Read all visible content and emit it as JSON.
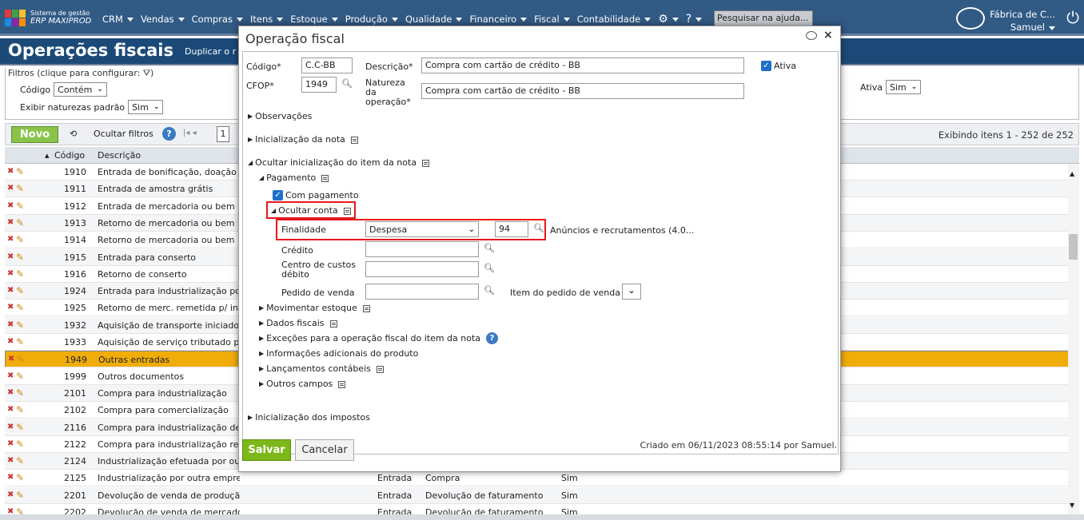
{
  "app": {
    "brand_line1": "Sistema de gestão",
    "brand_line2": "ERP MAXIPROD"
  },
  "menu": [
    "CRM",
    "Vendas",
    "Compras",
    "Itens",
    "Estoque",
    "Produção",
    "Qualidade",
    "Financeiro",
    "Fiscal",
    "Contabilidade"
  ],
  "help_search": {
    "placeholder": "Pesquisar na ajuda..."
  },
  "user": {
    "company": "Fábrica de C...",
    "name": "Samuel"
  },
  "page": {
    "title": "Operações fiscais",
    "duplicate_label": "Duplicar o r"
  },
  "filters": {
    "legend": "Filtros (clique para configurar:",
    "codigo_label": "Código",
    "codigo_op": "Contém",
    "naturezas_label": "Exibir naturezas padrão",
    "naturezas_value": "Sim",
    "ativa_label": "Ativa",
    "ativa_value": "Sim"
  },
  "toolbar": {
    "novo": "Novo",
    "hide_filters": "Ocultar filtros",
    "page": "1",
    "count": "Exibindo itens 1 - 252 de 252"
  },
  "grid": {
    "headers": {
      "codigo": "Código",
      "descricao": "Descrição"
    },
    "rows": [
      {
        "codigo": "1910",
        "descricao": "Entrada de bonificação, doação ou",
        "c3": "",
        "c4": "",
        "c5": ""
      },
      {
        "codigo": "1911",
        "descricao": "Entrada de amostra grátis",
        "c3": "",
        "c4": "",
        "c5": ""
      },
      {
        "codigo": "1912",
        "descricao": "Entrada de mercadoria ou bem rec",
        "c3": "",
        "c4": "",
        "c5": ""
      },
      {
        "codigo": "1913",
        "descricao": "Retorno de mercadoria ou bem re",
        "c3": "",
        "c4": "",
        "c5": ""
      },
      {
        "codigo": "1914",
        "descricao": "Retorno de mercadoria ou bem re",
        "c3": "",
        "c4": "",
        "c5": ""
      },
      {
        "codigo": "1915",
        "descricao": "Entrada para conserto",
        "c3": "",
        "c4": "",
        "c5": ""
      },
      {
        "codigo": "1916",
        "descricao": "Retorno de conserto",
        "c3": "",
        "c4": "",
        "c5": ""
      },
      {
        "codigo": "1924",
        "descricao": "Entrada para industrialização por",
        "c3": "",
        "c4": "",
        "c5": ""
      },
      {
        "codigo": "1925",
        "descricao": "Retorno de merc. remetida p/ ind",
        "c3": "",
        "c4": "",
        "c5": ""
      },
      {
        "codigo": "1932",
        "descricao": "Aquisição de transporte iniciado e",
        "c3": "",
        "c4": "",
        "c5": ""
      },
      {
        "codigo": "1933",
        "descricao": "Aquisição de serviço tributado pel",
        "c3": "",
        "c4": "",
        "c5": ""
      },
      {
        "codigo": "1949",
        "descricao": "Outras entradas",
        "c3": "",
        "c4": "",
        "c5": ""
      },
      {
        "codigo": "1999",
        "descricao": "Outros documentos",
        "c3": "",
        "c4": "",
        "c5": ""
      },
      {
        "codigo": "2101",
        "descricao": "Compra para industrialização",
        "c3": "",
        "c4": "",
        "c5": ""
      },
      {
        "codigo": "2102",
        "descricao": "Compra para comercialização",
        "c3": "",
        "c4": "",
        "c5": ""
      },
      {
        "codigo": "2116",
        "descricao": "Compra para industrialização de",
        "c3": "",
        "c4": "",
        "c5": ""
      },
      {
        "codigo": "2122",
        "descricao": "Compra para industrialização ren",
        "c3": "",
        "c4": "",
        "c5": ""
      },
      {
        "codigo": "2124",
        "descricao": "Industrialização efetuada por out",
        "c3": "",
        "c4": "",
        "c5": ""
      },
      {
        "codigo": "2125",
        "descricao": "Industrialização por outra empresa sem transitar pelo adq.",
        "c3": "Entrada",
        "c4": "Compra",
        "c5": "Sim"
      },
      {
        "codigo": "2201",
        "descricao": "Devolução de venda de produção do estabelecimento",
        "c3": "Entrada",
        "c4": "Devolução de faturamento",
        "c5": "Sim"
      },
      {
        "codigo": "2202",
        "descricao": "Devolução de venda de mercadoria adquirida de terceiros",
        "c3": "Entrada",
        "c4": "Devolução de faturamento",
        "c5": "Sim"
      }
    ]
  },
  "modal": {
    "title": "Operação fiscal",
    "codigo_label": "Código*",
    "codigo": "C.C-BB",
    "descricao_label": "Descrição*",
    "descricao": "Compra com cartão de crédito - BB",
    "ativa_label": "Ativa",
    "cfop_label": "CFOP*",
    "cfop": "1949",
    "natureza_label_1": "Natureza",
    "natureza_label_2": "da",
    "natureza_label_3": "operação*",
    "natureza": "Compra com cartão de crédito - BB",
    "observacoes": "Observações",
    "inicializacao_nota": "Inicialização da nota",
    "ocultar_item": "Ocultar inicialização do item da nota",
    "pagamento": "Pagamento",
    "com_pagamento": "Com pagamento",
    "ocultar_conta": "Ocultar conta",
    "finalidade_label": "Finalidade",
    "finalidade": "Despesa",
    "conta_codigo": "94",
    "conta_nome": "Anúncios e recrutamentos (4.0...",
    "credito_label": "Crédito",
    "centro_label_1": "Centro de custos",
    "centro_label_2": "débito",
    "pedido_label": "Pedido de venda",
    "item_pedido_label": "Item do pedido de venda",
    "movimentar": "Movimentar estoque",
    "dados_fiscais": "Dados fiscais",
    "excecoes": "Exceções para a operação fiscal do item da nota",
    "info_adicionais": "Informações adicionais do produto",
    "lancamentos": "Lançamentos contábeis",
    "outros_campos": "Outros campos",
    "inicializacao_impostos": "Inicialização dos impostos",
    "salvar": "Salvar",
    "cancelar": "Cancelar",
    "criado": "Criado em 06/11/2023 08:55:14 por Samuel."
  },
  "colors": {
    "header_blue": "#315a85",
    "title_blue": "#1c4a78",
    "save_green": "#7cb819",
    "selected_row": "#f0ad0a",
    "highlight_red": "#e8171b"
  }
}
